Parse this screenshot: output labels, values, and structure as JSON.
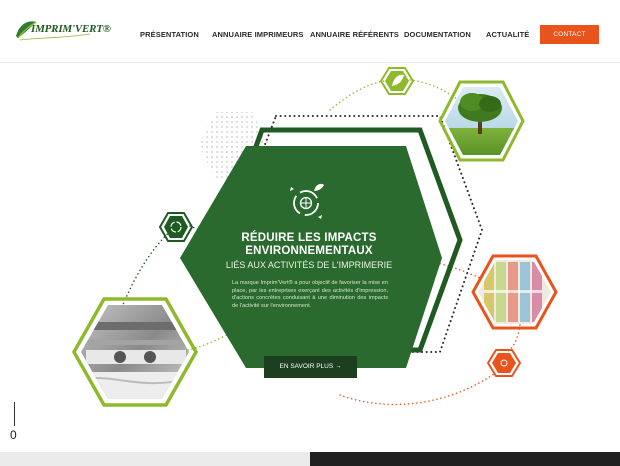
{
  "brand": {
    "name": "IMPRIM'VERT®"
  },
  "nav": {
    "items": [
      "PRÉSENTATION",
      "ANNUAIRE IMPRIMEURS",
      "ANNUAIRE RÉFÉRENTS",
      "DOCUMENTATION",
      "ACTUALITÉ"
    ],
    "contact_label": "CONTACT"
  },
  "hero": {
    "title_line1": "RÉDUIRE LES IMPACTS",
    "title_line2": "ENVIRONNEMENTAUX",
    "subtitle": "LIÉS AUX ACTIVITÉS DE L'IMPRIMERIE",
    "body": "La marque Imprim'Vert® a pour objectif de favoriser la mise en place, par les entreprises exerçant des activités d'impression, d'actions concrètes conduisant à une diminution des impacts de l'activité sur l'environnement.",
    "button_label": "EN SAVOIR PLUS →"
  },
  "scroll": {
    "index": "0"
  },
  "colors": {
    "green_dark": "#1f5a22",
    "green_light": "#8fb92d",
    "orange": "#e8541c"
  },
  "icons": [
    "leaf-logo-icon",
    "recycle-globe-icon",
    "leaf-hex-icon",
    "recycle-hex-icon",
    "orange-hex-icon"
  ]
}
